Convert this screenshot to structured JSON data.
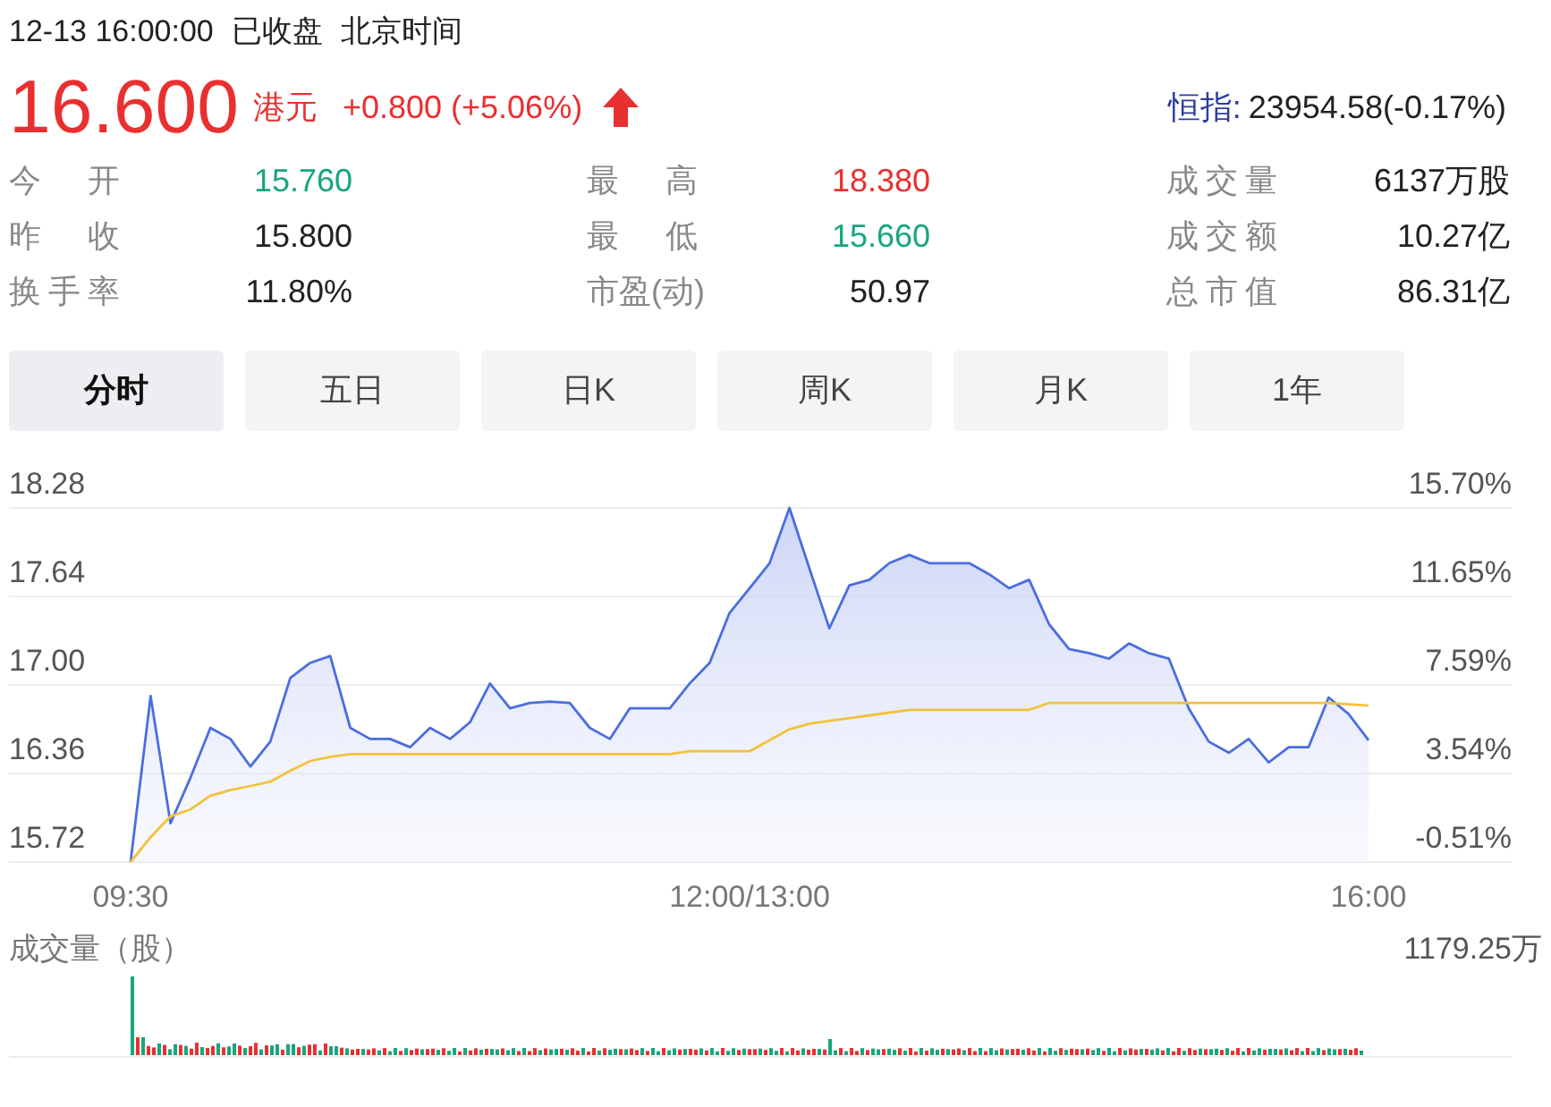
{
  "header": {
    "datetime": "12-13 16:00:00",
    "status": "已收盘",
    "timezone": "北京时间"
  },
  "quote": {
    "price": "16.600",
    "currency": "港元",
    "change": "+0.800 (+5.06%)",
    "color": "#e93030",
    "rising": true,
    "index_label": "恒指:",
    "index_value": "23954.58(-0.17%)"
  },
  "stats": [
    {
      "label": "今 开",
      "value": "15.760",
      "color": "#17a67e"
    },
    {
      "label": "最 高",
      "value": "18.380",
      "color": "#e93030"
    },
    {
      "label": "成交量",
      "value": "6137万股",
      "color": "#222222"
    },
    {
      "label": "昨 收",
      "value": "15.800",
      "color": "#222222"
    },
    {
      "label": "最 低",
      "value": "15.660",
      "color": "#17a67e"
    },
    {
      "label": "成交额",
      "value": "10.27亿",
      "color": "#222222"
    },
    {
      "label": "换手率",
      "value": "11.80%",
      "color": "#222222"
    },
    {
      "label": "市盈(动)",
      "value": "50.97",
      "color": "#222222"
    },
    {
      "label": "总市值",
      "value": "86.31亿",
      "color": "#222222"
    }
  ],
  "tabs": [
    {
      "label": "分时",
      "selected": true
    },
    {
      "label": "五日",
      "selected": false
    },
    {
      "label": "日K",
      "selected": false
    },
    {
      "label": "周K",
      "selected": false
    },
    {
      "label": "月K",
      "selected": false
    },
    {
      "label": "1年",
      "selected": false
    }
  ],
  "intraday_chart": {
    "right_axis_labels": [
      "15.70%",
      "11.65%",
      "7.59%",
      "3.54%",
      "-0.51%"
    ],
    "chart_data": {
      "type": "area",
      "grid": true,
      "ylim": [
        15.72,
        18.28
      ],
      "categories": [
        "09:30",
        null,
        null,
        null,
        null,
        null,
        null,
        null,
        null,
        null,
        null,
        null,
        null,
        null,
        null,
        null,
        null,
        null,
        null,
        null,
        null,
        null,
        null,
        null,
        null,
        null,
        null,
        null,
        null,
        null,
        null,
        "12:00/13:00",
        null,
        null,
        null,
        null,
        null,
        null,
        null,
        null,
        null,
        null,
        null,
        null,
        null,
        null,
        null,
        null,
        null,
        null,
        null,
        null,
        null,
        null,
        null,
        null,
        null,
        null,
        null,
        null,
        null,
        null,
        "16:00"
      ],
      "yticks": [
        {
          "value": 18.28,
          "label": "18.28"
        },
        {
          "value": 17.64,
          "label": "17.64"
        },
        {
          "value": 17.0,
          "label": "17.00"
        },
        {
          "value": 16.36,
          "label": "16.36"
        },
        {
          "value": 15.72,
          "label": "15.72"
        }
      ],
      "series": [
        {
          "color": "#4a6ee0",
          "type": "area",
          "values": [
            15.72,
            16.92,
            16.0,
            16.33,
            16.69,
            16.61,
            16.41,
            16.59,
            17.05,
            17.16,
            17.21,
            16.69,
            16.61,
            16.61,
            16.55,
            16.69,
            16.61,
            16.73,
            17.01,
            16.83,
            16.87,
            16.88,
            16.87,
            16.69,
            16.61,
            16.83,
            16.83,
            16.83,
            17.01,
            17.16,
            17.52,
            17.7,
            17.88,
            18.28,
            17.84,
            17.41,
            17.72,
            17.76,
            17.88,
            17.94,
            17.88,
            17.88,
            17.88,
            17.8,
            17.7,
            17.76,
            17.44,
            17.26,
            17.23,
            17.19,
            17.3,
            17.23,
            17.19,
            16.83,
            16.59,
            16.51,
            16.61,
            16.44,
            16.55,
            16.55,
            16.91,
            16.79,
            16.6
          ]
        },
        {
          "color": "#f2c23a",
          "type": "line",
          "values": [
            15.72,
            15.9,
            16.05,
            16.1,
            16.2,
            16.24,
            16.27,
            16.3,
            16.38,
            16.45,
            16.48,
            16.5,
            16.5,
            16.5,
            16.5,
            16.5,
            16.5,
            16.5,
            16.5,
            16.5,
            16.5,
            16.5,
            16.5,
            16.5,
            16.5,
            16.5,
            16.5,
            16.5,
            16.52,
            16.52,
            16.52,
            16.52,
            16.6,
            16.68,
            16.72,
            16.74,
            16.76,
            16.78,
            16.8,
            16.82,
            16.82,
            16.82,
            16.82,
            16.82,
            16.82,
            16.82,
            16.87,
            16.87,
            16.87,
            16.87,
            16.87,
            16.87,
            16.87,
            16.87,
            16.87,
            16.87,
            16.87,
            16.87,
            16.87,
            16.87,
            16.87,
            16.86,
            16.85
          ]
        }
      ]
    }
  },
  "volume": {
    "label": "成交量（股）",
    "max_label": "1179.25万"
  }
}
